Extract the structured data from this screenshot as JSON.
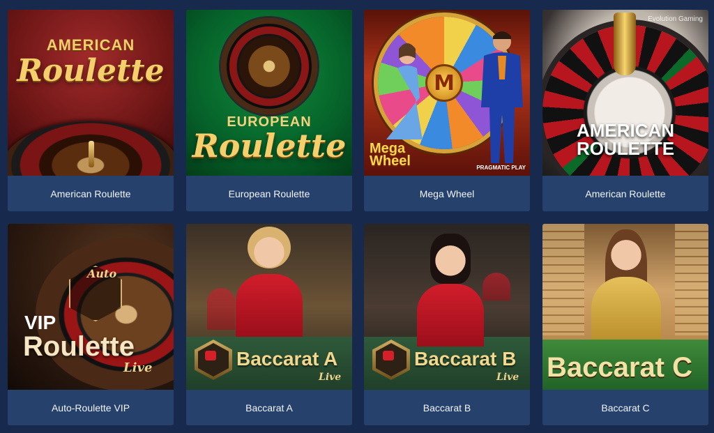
{
  "games": [
    {
      "name": "American Roulette",
      "art": {
        "line1": "AMERICAN",
        "line2": "Roulette"
      }
    },
    {
      "name": "European Roulette",
      "art": {
        "line1": "EUROPEAN",
        "line2": "Roulette"
      }
    },
    {
      "name": "Mega Wheel",
      "art": {
        "line1": "Mega",
        "line2": "Wheel",
        "provider": "PRAGMATIC PLAY",
        "hub": "M"
      }
    },
    {
      "name": "American Roulette",
      "art": {
        "line1": "AMERICAN",
        "line2": "ROULETTE",
        "provider": "Evolution Gaming"
      }
    },
    {
      "name": "Auto-Roulette VIP",
      "art": {
        "tag": "Auto",
        "line1": "VIP",
        "line2": "Roulette",
        "live": "Live"
      }
    },
    {
      "name": "Baccarat A",
      "art": {
        "line1": "Baccarat A",
        "live": "Live"
      }
    },
    {
      "name": "Baccarat B",
      "art": {
        "line1": "Baccarat B",
        "live": "Live"
      }
    },
    {
      "name": "Baccarat C",
      "art": {
        "line1": "Baccarat C"
      }
    }
  ],
  "colors": {
    "page_bg": "#172a4e",
    "label_bg": "#25416c",
    "label_text": "#f1f4fa",
    "gold": "#f4cf6b"
  }
}
